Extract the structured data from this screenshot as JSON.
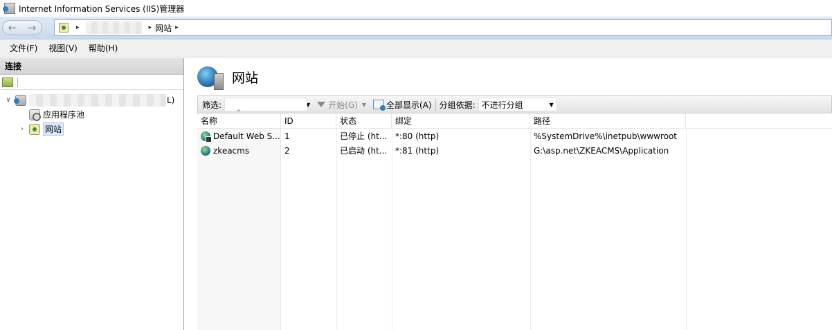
{
  "window": {
    "title": "Internet Information Services (IIS)管理器"
  },
  "address": {
    "current": "网站"
  },
  "menu": {
    "items": [
      "文件(F)",
      "视图(V)",
      "帮助(H)"
    ]
  },
  "connections": {
    "header": "连接",
    "tree": {
      "server_suffix": "L)",
      "children": [
        "应用程序池",
        "网站"
      ]
    }
  },
  "content": {
    "title": "网站",
    "filter": {
      "label": "筛选:",
      "start_label": "开始(G)",
      "showall_label": "全部显示(A)",
      "groupby_label": "分组依据:",
      "groupby_value": "不进行分组"
    },
    "table": {
      "columns": [
        "名称",
        "ID",
        "状态",
        "绑定",
        "路径"
      ],
      "rows": [
        {
          "name": "Default Web S...",
          "id": "1",
          "status": "已停止 (ht...",
          "binding": "*:80 (http)",
          "path": "%SystemDrive%\\inetpub\\wwwroot"
        },
        {
          "name": "zkeacms",
          "id": "2",
          "status": "已启动 (ht...",
          "binding": "*:81 (http)",
          "path": "G:\\asp.net\\ZKEACMS\\Application"
        }
      ]
    }
  }
}
